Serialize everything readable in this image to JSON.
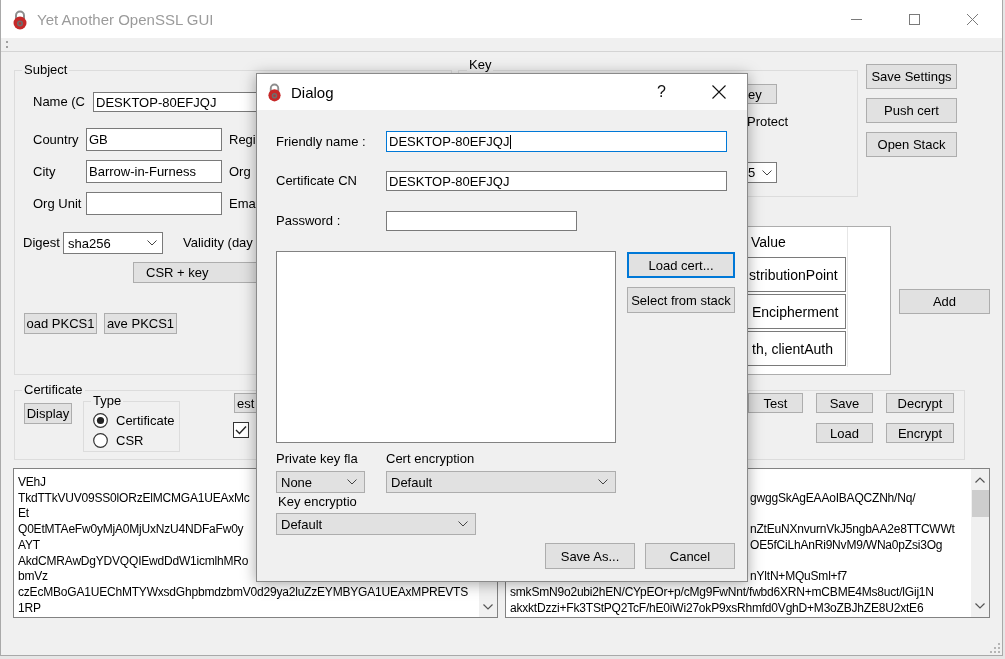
{
  "window": {
    "title": "Yet Another OpenSSL GUI"
  },
  "subject": {
    "title": "Subject",
    "name": {
      "label": "Name (C",
      "value": "DESKTOP-80EFJQJ"
    },
    "fields": [
      {
        "label": "Country",
        "value": "GB",
        "next_label": "Regi"
      },
      {
        "label": "City",
        "value": "Barrow-in-Furness",
        "next_label": "Org"
      },
      {
        "label": "Org Unit",
        "next_label": "Ema"
      }
    ],
    "digest": {
      "label": "Digest",
      "value": "sha256"
    },
    "validity_label": "Validity (day",
    "csr_button": "CSR + key",
    "pkcs12_buttons": [
      "oad PKCS1",
      "ave PKCS1"
    ]
  },
  "key": {
    "title": "Key",
    "button": "ey",
    "protected_label": "Protect",
    "size_value": "5"
  },
  "side_buttons": [
    "Save Settings",
    "Push cert",
    "Open Stack"
  ],
  "extensions": {
    "header": "Value",
    "values": [
      "stributionPoint",
      "Encipherment",
      "th, clientAuth"
    ],
    "add_button": "Add"
  },
  "certificate": {
    "title": "Certificate",
    "display_button": "Display",
    "type": {
      "title": "Type",
      "options": [
        {
          "label": "Certificate",
          "selected": true
        },
        {
          "label": "CSR",
          "selected": false
        }
      ]
    },
    "request_button": "est",
    "option_checkbox": {
      "checked": true
    }
  },
  "actions": {
    "rows": [
      [
        "Test",
        "Save",
        "Decrypt"
      ],
      [
        "",
        "Load",
        "Encrypt"
      ]
    ]
  },
  "left_text": {
    "lines": [
      "VEhJ",
      "TkdTTkVUV09SS0lORzElMCMGA1UEAxMc",
      "Et",
      "Q0EtMTAeFw0yMjA0MjUxNzU4NDFaFw0y",
      "AYT",
      "AkdCMRAwDgYDVQQIEwdDdW1icmlhMRo",
      "bmVz",
      "czEcMBoGA1UEChMTYWxsdGhpbmdzbmV0d29ya2luZzEYMBYGA1UEAxMPREVTS",
      "1RP"
    ]
  },
  "right_text": {
    "visible_tails": [
      [
        "gwggSkAgEAAoIBAQCZNh/Nq/"
      ],
      [
        "nZtEuNXnvurnVkJ5ngbAA2e8TTCWWt",
        "OE5fCiLhAnRi9NvM9/WNa0pZsi3Og"
      ],
      [
        "nYltN+MQuSml+f7"
      ]
    ],
    "lines": [
      "smkSmN9o2ubi2hEN/CYpEOr+p/cMg9FwNnt/fwbd6XRN+mCBME4Ms8uct/lGij1N",
      "akxktDzzi+Fk3TStPQ2TcF/hE0iWi27okP9xsRhmfd0VghD+M3oZBJhZE8U2xtE6"
    ]
  },
  "dialog": {
    "title": "Dialog",
    "help_button": "?",
    "fields": [
      {
        "label": "Friendly name :",
        "kind": "text",
        "value": "DESKTOP-80EFJQJ",
        "focused": true
      },
      {
        "label": "Certificate CN",
        "kind": "text",
        "value": "DESKTOP-80EFJQJ",
        "focused": false
      },
      {
        "label": "Password :",
        "kind": "password",
        "focused": false
      }
    ],
    "list_buttons": [
      {
        "label": "Load cert...",
        "focused": true
      },
      {
        "label": "Select from stack",
        "focused": false
      }
    ],
    "private_key_flags": {
      "label": "Private key fla",
      "value": "None"
    },
    "cert_encryption": {
      "label": "Cert encryption",
      "value": "Default"
    },
    "key_encryption": {
      "label": "Key encryptio",
      "value": "Default"
    },
    "buttons": [
      "Save As...",
      "Cancel"
    ]
  }
}
